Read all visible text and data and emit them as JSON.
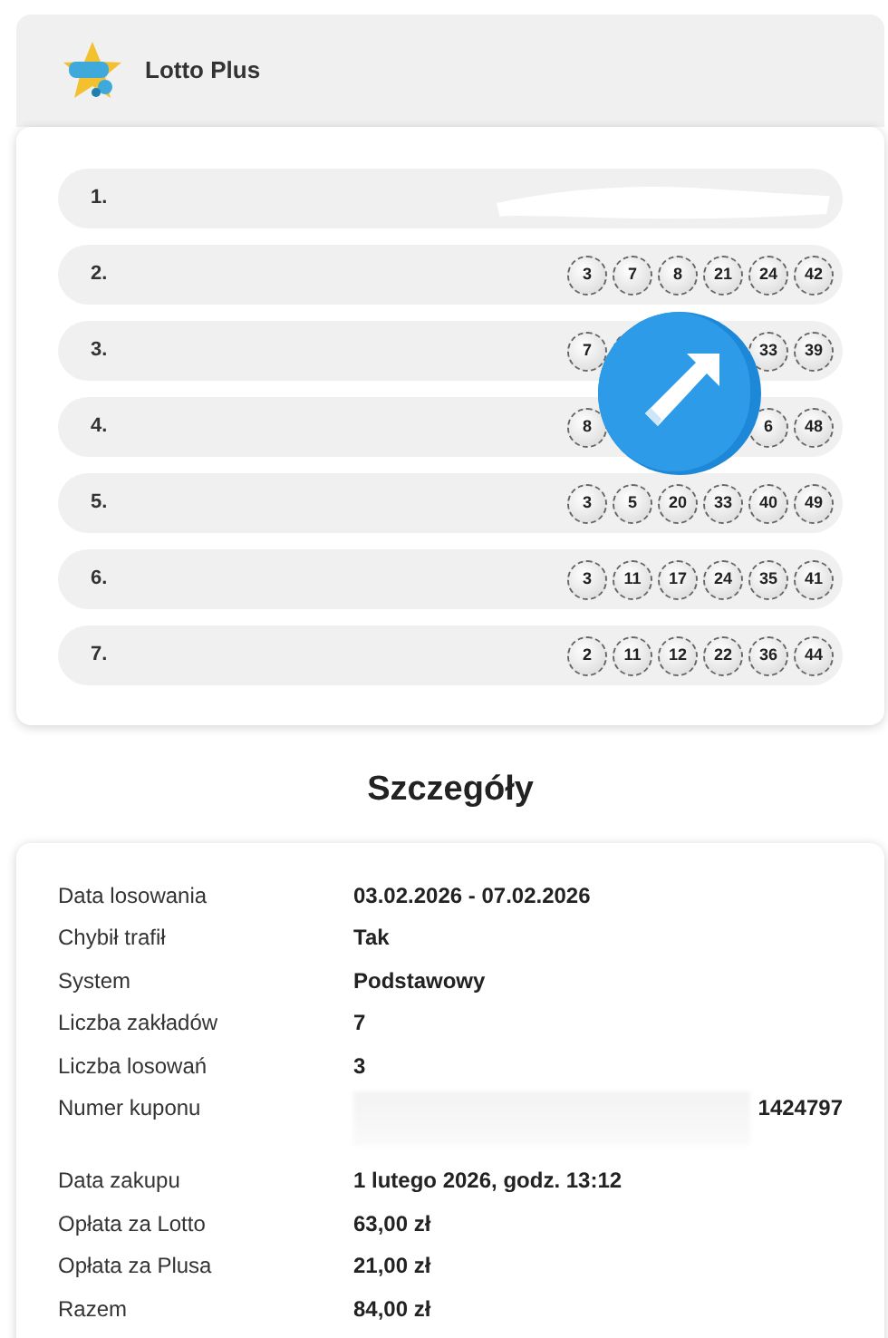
{
  "header": {
    "title": "Lotto Plus"
  },
  "bets": [
    {
      "index": "1.",
      "redacted": true
    },
    {
      "index": "2.",
      "balls": [
        "3",
        "7",
        "8",
        "21",
        "24",
        "42"
      ]
    },
    {
      "index": "3.",
      "partially_covered": true,
      "balls": [
        "7",
        "33",
        "39"
      ]
    },
    {
      "index": "4.",
      "partially_covered": true,
      "balls": [
        "8",
        "6",
        "48"
      ]
    },
    {
      "index": "5.",
      "balls": [
        "3",
        "5",
        "20",
        "33",
        "40",
        "49"
      ]
    },
    {
      "index": "6.",
      "balls": [
        "3",
        "11",
        "17",
        "24",
        "35",
        "41"
      ]
    },
    {
      "index": "7.",
      "balls": [
        "2",
        "11",
        "12",
        "22",
        "36",
        "44"
      ]
    }
  ],
  "details": {
    "title": "Szczegóły",
    "rows": [
      {
        "label": "Data losowania",
        "value": "03.02.2026 - 07.02.2026"
      },
      {
        "label": "Chybił trafił",
        "value": "Tak"
      },
      {
        "label": "System",
        "value": "Podstawowy"
      },
      {
        "label": "Liczba zakładów",
        "value": "7"
      },
      {
        "label": "Liczba losowań",
        "value": "3"
      },
      {
        "label": "Numer kuponu",
        "value": "1424797",
        "redacted": true
      },
      {
        "label": "Data zakupu",
        "value": "1 lutego 2026, godz. 13:12"
      },
      {
        "label": "Opłata za Lotto",
        "value": "63,00 zł"
      },
      {
        "label": "Opłata za Plusa",
        "value": "21,00 zł"
      },
      {
        "label": "Razem",
        "value": "84,00 zł"
      }
    ]
  }
}
